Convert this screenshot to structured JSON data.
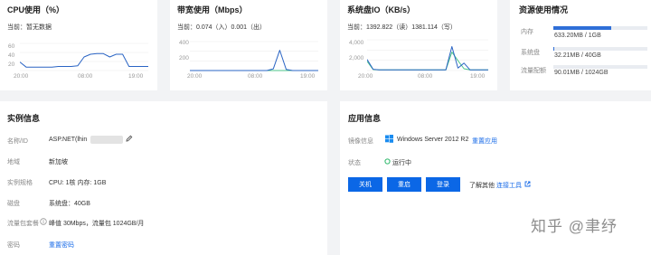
{
  "colors": {
    "accent": "#1a6ce8",
    "line_blue": "#2a64c4",
    "line_green": "#4cc58a",
    "grid": "#eeeeee"
  },
  "cpu": {
    "title": "CPU使用（%）",
    "current_prefix": "当前：",
    "current_value": "暂无数据",
    "yticks": [
      "60",
      "40",
      "20"
    ],
    "xticks": [
      "20:00",
      "08:00",
      "19:00"
    ]
  },
  "bandwidth": {
    "title": "带宽使用（Mbps）",
    "current_prefix": "当前：",
    "current_value": "0.074（入）0.001（出）",
    "yticks": [
      "400",
      "200"
    ],
    "xticks": [
      "20:00",
      "08:00",
      "19:00"
    ]
  },
  "disk_io": {
    "title": "系统盘IO（KB/s）",
    "current_prefix": "当前：",
    "current_value": "1392.822（读）1381.114（写）",
    "yticks": [
      "4,000",
      "2,000"
    ],
    "xticks": [
      "20:00",
      "08:00",
      "19:00"
    ]
  },
  "resources": {
    "title": "资源使用情况",
    "rows": [
      {
        "label": "内存",
        "value": "633.20MB / 1GB",
        "fraction": 0.62
      },
      {
        "label": "系统盘",
        "value": "32.21MB / 40GB",
        "fraction": 0.01
      },
      {
        "label": "流量配额",
        "value": "90.01MB / 1024GB",
        "fraction": 0.0
      }
    ]
  },
  "instance": {
    "title": "实例信息",
    "rows": [
      {
        "label": "名称/ID",
        "value": "ASP.NET(lhin"
      },
      {
        "label": "地域",
        "value": "新加坡"
      },
      {
        "label": "实例规格",
        "value": "CPU: 1核 内存: 1GB"
      },
      {
        "label": "磁盘",
        "value": "系统盘：40GB"
      },
      {
        "label": "流量包套餐",
        "value": "峰值 30Mbps，流量包 1024GB/月"
      },
      {
        "label": "密码",
        "value": "重置密码"
      }
    ]
  },
  "app": {
    "title": "应用信息",
    "image_label": "镜像信息",
    "image_value": "Windows Server 2012 R2",
    "reset_app": "重置应用",
    "status_label": "状态",
    "status_value": "运行中",
    "buttons": [
      "关机",
      "重启",
      "登录"
    ],
    "more_text": "了解其他",
    "more_link": "连接工具"
  },
  "watermark": "知乎 @聿纾",
  "chart_data": [
    {
      "type": "line",
      "title": "CPU使用（%）",
      "x": [
        "20:00",
        "08:00",
        "19:00"
      ],
      "ylim": [
        0,
        80
      ],
      "series": [
        {
          "values": [
            25,
            10,
            10,
            10,
            10,
            10,
            12,
            12,
            12,
            14,
            40,
            48,
            50,
            50,
            40,
            48,
            48,
            12,
            12,
            12,
            12
          ]
        }
      ]
    },
    {
      "type": "line",
      "title": "带宽使用（Mbps）",
      "x": [
        "20:00",
        "08:00",
        "19:00"
      ],
      "ylim": [
        0,
        500
      ],
      "series": [
        {
          "values": [
            0,
            0,
            0,
            0,
            0,
            0,
            0,
            0,
            0,
            0,
            0,
            0,
            0,
            30,
            350,
            20,
            0,
            0,
            0,
            0,
            0
          ]
        },
        {
          "values": [
            0,
            0,
            0,
            0,
            0,
            0,
            0,
            0,
            0,
            0,
            0,
            0,
            0,
            0,
            0,
            0,
            0,
            0,
            0,
            0,
            0
          ]
        }
      ]
    },
    {
      "type": "line",
      "title": "系统盘IO（KB/s）",
      "x": [
        "20:00",
        "08:00",
        "19:00"
      ],
      "ylim": [
        0,
        5000
      ],
      "series": [
        {
          "values": [
            1800,
            200,
            100,
            100,
            100,
            100,
            100,
            100,
            100,
            100,
            100,
            100,
            100,
            100,
            3900,
            400,
            1200,
            100,
            100,
            100,
            100
          ]
        },
        {
          "values": [
            1500,
            150,
            100,
            100,
            100,
            100,
            100,
            100,
            100,
            100,
            100,
            100,
            100,
            100,
            3000,
            1600,
            300,
            100,
            100,
            100,
            100
          ]
        }
      ]
    }
  ]
}
